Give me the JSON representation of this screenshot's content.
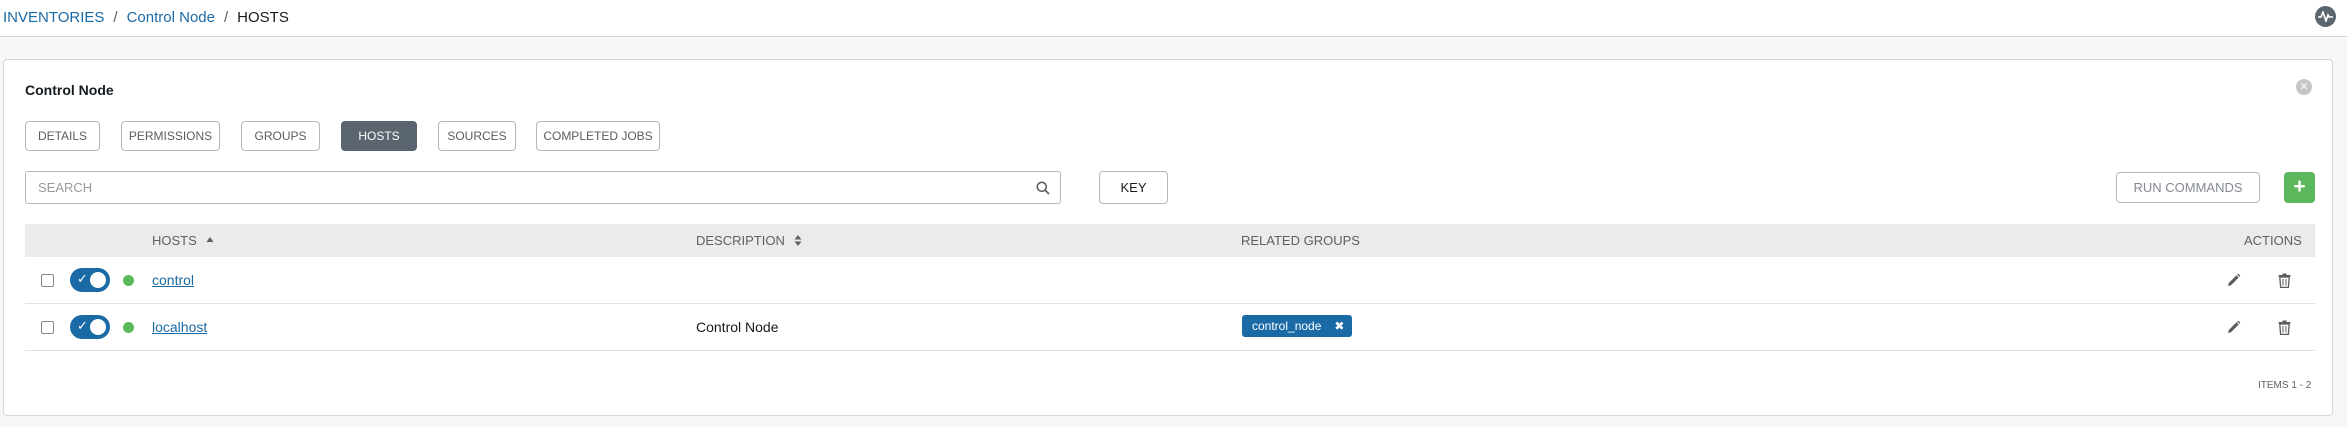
{
  "breadcrumb": {
    "items": [
      "INVENTORIES",
      "Control Node",
      "HOSTS"
    ],
    "separator": "/"
  },
  "panel": {
    "title": "Control Node",
    "tabs": [
      {
        "label": "DETAILS",
        "active": false
      },
      {
        "label": "PERMISSIONS",
        "active": false
      },
      {
        "label": "GROUPS",
        "active": false
      },
      {
        "label": "HOSTS",
        "active": true
      },
      {
        "label": "SOURCES",
        "active": false
      },
      {
        "label": "COMPLETED JOBS",
        "active": false
      }
    ]
  },
  "search": {
    "placeholder": "SEARCH",
    "key_label": "KEY"
  },
  "toolbar": {
    "run_commands_label": "RUN COMMANDS",
    "add_label": "+"
  },
  "table": {
    "columns": {
      "hosts": "HOSTS",
      "description": "DESCRIPTION",
      "related_groups": "RELATED GROUPS",
      "actions": "ACTIONS"
    },
    "rows": [
      {
        "name": "control",
        "description": "",
        "groups": [],
        "enabled": true,
        "status": "ok"
      },
      {
        "name": "localhost",
        "description": "Control Node",
        "groups": [
          "control_node"
        ],
        "enabled": true,
        "status": "ok"
      }
    ],
    "items_label": "ITEMS  1 - 2"
  },
  "colors": {
    "accent": "#1a6aa5",
    "success": "#5cb85c",
    "tab_active": "#5b6570"
  },
  "icons": [
    "activity-stream-icon",
    "close-icon",
    "search-icon",
    "sort-asc-icon",
    "sort-icon",
    "check-icon",
    "status-ok-icon",
    "edit-icon",
    "delete-icon",
    "remove-tag-icon"
  ]
}
